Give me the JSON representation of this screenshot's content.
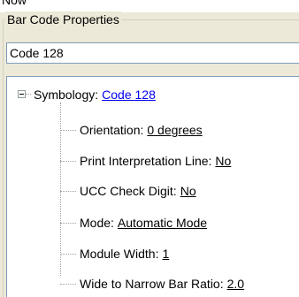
{
  "top_strip": {
    "text": "Now"
  },
  "group": {
    "title": "Bar Code Properties"
  },
  "field": {
    "value": "Code 128"
  },
  "tree": {
    "root": {
      "label": "Symbology:",
      "value": "Code 128"
    },
    "children": [
      {
        "label": "Orientation:",
        "value": "0 degrees"
      },
      {
        "label": "Print Interpretation Line:",
        "value": "No"
      },
      {
        "label": "UCC Check Digit:",
        "value": "No"
      },
      {
        "label": "Mode:",
        "value": "Automatic Mode"
      },
      {
        "label": "Module Width:",
        "value": "1"
      },
      {
        "label": "Wide to Narrow Bar Ratio:",
        "value": "2.0"
      }
    ]
  },
  "colors": {
    "background": "#ece9d8",
    "link": "#0000ee",
    "border": "#7f9db9"
  }
}
